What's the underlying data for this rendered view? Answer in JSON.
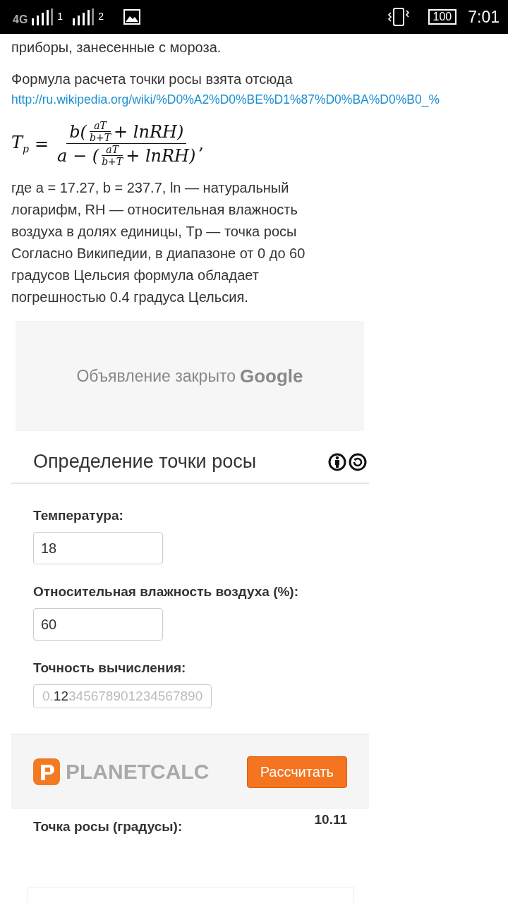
{
  "status_bar": {
    "network": "4G",
    "sim_1": "1",
    "sim_2": "2",
    "battery": "100",
    "time": "7:01"
  },
  "article": {
    "intro": "приборы, занесенные с мороза.",
    "source_text": "Формула расчета точки росы взята отсюда",
    "source_link": "http://ru.wikipedia.org/wiki/%D0%A2%D0%BE%D1%87%D0%BA%D0%B0_%",
    "formula": {
      "lhs": "T",
      "lhs_sub": "p",
      "equals": "=",
      "numerator": {
        "before": "b(",
        "frac_num": "aT",
        "frac_den": "b+T",
        "after": "+ lnRH)"
      },
      "denominator": {
        "before": "a − (",
        "frac_num": "aT",
        "frac_den": "b+T",
        "after": "+ lnRH)"
      },
      "trailing": ","
    },
    "explanation": "где a = 17.27, b = 237.7, ln — натуральный логарифм, RH — относительная влажность воздуха в долях единицы, Tp — точка росы Согласно Википедии, в диапазоне от 0 до 60 градусов Цельсия формула обладает погрешностью 0.4 градуса Цельсия."
  },
  "ad": {
    "text": "Объявление закрыто",
    "brand": "Google"
  },
  "calculator": {
    "title": "Определение точки росы",
    "fields": [
      {
        "label": "Температура:",
        "value": "18"
      },
      {
        "label": "Относительная влажность воздуха (%):",
        "value": "60"
      }
    ],
    "precision": {
      "label": "Точность вычисления:",
      "segments": [
        {
          "text": "0.",
          "selected": false
        },
        {
          "text": "12",
          "selected": true
        },
        {
          "text": "345678901234567890",
          "selected": false
        }
      ]
    },
    "logo_text": "PLANETCALC",
    "button": "Рассчитать",
    "result": {
      "label": "Точка росы (градусы):",
      "value": "10.11"
    }
  }
}
